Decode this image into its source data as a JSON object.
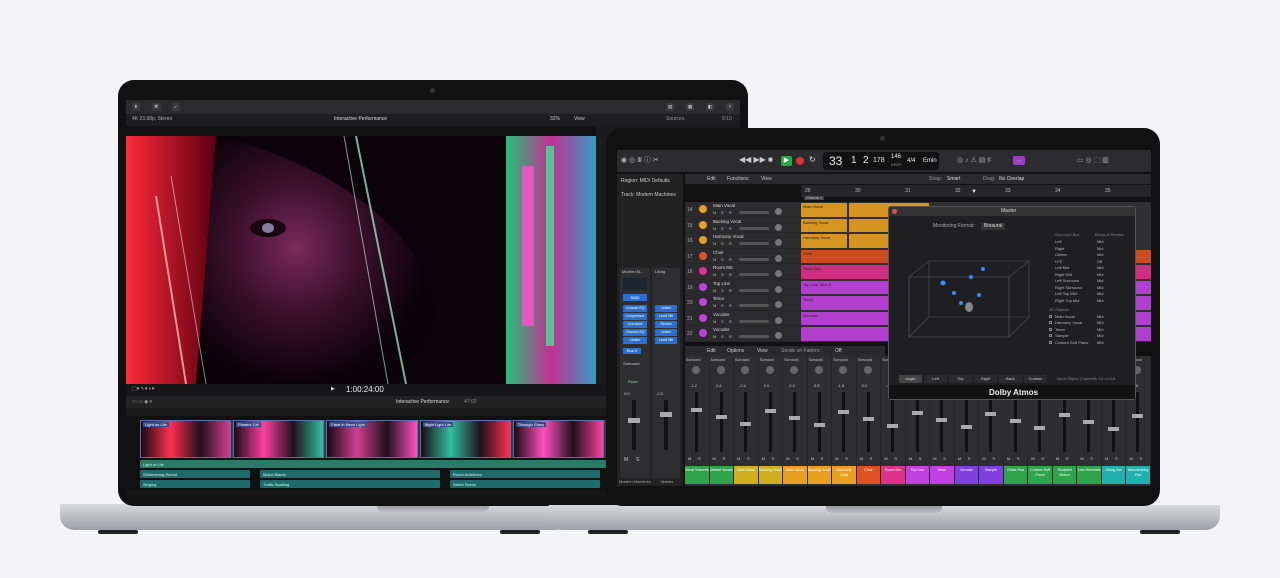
{
  "fcp": {
    "meta_left": "4K 23.98p, Stereo",
    "title": "Interactive Performance",
    "zoom": "32%",
    "view": "View",
    "inspector_label": "Sources",
    "inspector_value": "9:10",
    "timecode": "1:00:24:00",
    "timeline_title": "Interactive Performance",
    "timeline_duration": "47:02",
    "clips": [
      "Light on Life",
      "Powers Girl",
      "Face in Neon Light",
      "Night Light Life",
      "Through Glass"
    ],
    "audio_lanes": [
      [
        "Light or Life",
        "",
        ""
      ],
      [
        "Shimmering Sound",
        "Motor Blares",
        "Room Ambience"
      ],
      [
        "Singing",
        "Traffic Bustling",
        "Street Sirens"
      ]
    ]
  },
  "logic": {
    "region": "Region: MIDI Defaults",
    "track": "Track: Modern Machines",
    "lcd": {
      "bars": "33",
      "beat": "1",
      "sub": "2",
      "ticks": "178",
      "tempo": "146",
      "tempo_label": "KEEP",
      "sig": "4/4",
      "key": "Emin"
    },
    "edit_menu": [
      "Edit",
      "Functions",
      "View"
    ],
    "snap": "Snap:",
    "snap_value": "Smart",
    "drag": "Drag:",
    "drag_value": "No Overlap",
    "marker": "Chorus 1",
    "ruler": [
      "29",
      "30",
      "31",
      "32",
      "33",
      "34",
      "35"
    ],
    "tracks": [
      {
        "num": "14",
        "name": "Main Vocal",
        "color": "#e8a020"
      },
      {
        "num": "15",
        "name": "Backing Vocal",
        "color": "#e8a020"
      },
      {
        "num": "16",
        "name": "Harmony Vocal",
        "color": "#e8a020"
      },
      {
        "num": "17",
        "name": "Choir",
        "color": "#e05020"
      },
      {
        "num": "18",
        "name": "Room Mic",
        "color": "#e0308a"
      },
      {
        "num": "19",
        "name": "Top Line",
        "color": "#c040e0"
      },
      {
        "num": "20",
        "name": "Tenor",
        "color": "#c040e0"
      },
      {
        "num": "21",
        "name": "Vocoder",
        "color": "#c040e0"
      },
      {
        "num": "22",
        "name": "Vocoder",
        "color": "#c040e0"
      }
    ],
    "regions": [
      "Main Vocal",
      "Backing Vocal",
      "Harmony Vocal",
      "Choir",
      "Room Mic",
      "Top Line Take 8",
      "Tenor",
      "Vocoder"
    ],
    "channel": {
      "name": "Modern M...",
      "name2": "Using",
      "mode": "SMD",
      "plugins": [
        "Console EQ",
        "Compressor",
        "Overdrive",
        "Channel EQ",
        "Limiter"
      ],
      "plugins2": [
        "Limiter",
        "Level Mtr",
        "Reverb",
        "Limiter",
        "Level Mtr"
      ],
      "bus": "Bus 2",
      "out": "Surround",
      "read": "Read",
      "vol": "0.0",
      "vol2": "-2.5",
      "m": "M",
      "s": "S",
      "bottom": [
        "Modern Machines",
        "Master"
      ]
    },
    "mixer_menu": [
      "Edit",
      "Options",
      "View"
    ],
    "sends": "Sends on Faders:",
    "sends_value": "Off",
    "strips": [
      {
        "name": "Vocal Textures",
        "color": "#2ea54a"
      },
      {
        "name": "Distant Vocals",
        "color": "#2ea54a"
      },
      {
        "name": "Main Vocal",
        "color": "#d0b020"
      },
      {
        "name": "Backing Vocal",
        "color": "#d0b020"
      },
      {
        "name": "Main Vocal",
        "color": "#e8a020"
      },
      {
        "name": "Backing Vocal",
        "color": "#e8a020"
      },
      {
        "name": "Harmony Vocal",
        "color": "#e8a020"
      },
      {
        "name": "Choir",
        "color": "#e05020"
      },
      {
        "name": "Room Mic",
        "color": "#e0308a"
      },
      {
        "name": "Top Line",
        "color": "#c040e0"
      },
      {
        "name": "Tenor",
        "color": "#c040e0"
      },
      {
        "name": "Vocoder",
        "color": "#8040e0"
      },
      {
        "name": "Sample",
        "color": "#8040e0"
      },
      {
        "name": "Glass Pad",
        "color": "#2ea54a"
      },
      {
        "name": "Custom Soft Piano",
        "color": "#2ea54a"
      },
      {
        "name": "Sculpted Motion",
        "color": "#2ea54a"
      },
      {
        "name": "Line Wavelets",
        "color": "#2ea54a"
      },
      {
        "name": "String Vox",
        "color": "#20b0b0"
      },
      {
        "name": "Mesmerizing Pad",
        "color": "#20b0b0"
      }
    ],
    "strip_values": [
      "-1.2",
      "-3.4",
      "-2.4",
      "0.0",
      "-2.8",
      "-3.8",
      "-1.8",
      "0.0",
      "-4.6",
      "-2.2",
      "-1.8",
      "-2.4",
      "-3.8",
      "-1.1",
      "0.0",
      "-2.7",
      "-1.4",
      "-3.1",
      "-0.6"
    ],
    "master": {
      "title": "Master",
      "monitoring_label": "Monitoring Format:",
      "monitoring_value": "Binaural",
      "col1": "Surround Bus",
      "col2": "Binaural Render",
      "channels": [
        [
          "Left",
          "Mid"
        ],
        [
          "Right",
          "Mid"
        ],
        [
          "Center",
          "Mid"
        ],
        [
          "LFE",
          "Off"
        ],
        [
          "Left Mid",
          "Mid"
        ],
        [
          "Right Mid",
          "Mid"
        ],
        [
          "Left Surround",
          "Mid"
        ],
        [
          "Right Surround",
          "Mid"
        ],
        [
          "Left Top Mid",
          "Mid"
        ],
        [
          "Right Top Mid",
          "Mid"
        ]
      ],
      "objects_label": "3D Objects",
      "objects": [
        [
          "Main Vocal",
          "Mid"
        ],
        [
          "Harmony Vocal",
          "Mid"
        ],
        [
          "Tenor",
          "Mid"
        ],
        [
          "Sample",
          "Mid"
        ],
        [
          "Custom Soft Piano",
          "Mid"
        ]
      ],
      "tabs": [
        "Angle",
        "Left",
        "Top",
        "Right",
        "Back",
        "Custom"
      ],
      "footer_note": "Input Object Channels: 13 of 118",
      "brand": "Dolby Atmos"
    }
  }
}
